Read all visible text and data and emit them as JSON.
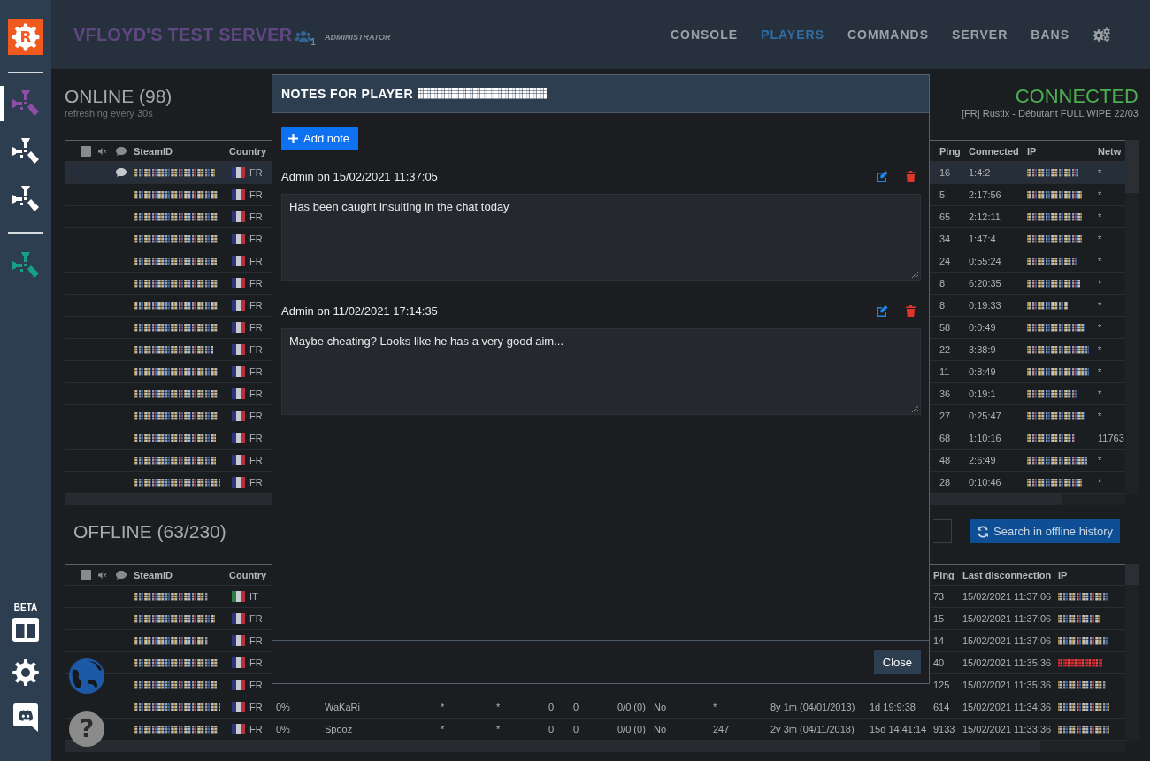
{
  "sidebar": {
    "logo": "R",
    "servers": [
      {
        "color": "#8e4ea8",
        "selected": true
      },
      {
        "color": "#ffffff",
        "selected": false
      },
      {
        "color": "#ffffff",
        "selected": false
      }
    ],
    "other_servers": [
      {
        "color": "#16a085",
        "selected": false
      }
    ],
    "beta_label": "BETA"
  },
  "header": {
    "title": "VFLOYD'S TEST SERVER",
    "users_count": "1",
    "role": "ADMINISTRATOR",
    "nav": [
      {
        "label": "CONSOLE",
        "selected": false
      },
      {
        "label": "PLAYERS",
        "selected": true
      },
      {
        "label": "COMMANDS",
        "selected": false
      },
      {
        "label": "SERVER",
        "selected": false
      },
      {
        "label": "BANS",
        "selected": false
      }
    ]
  },
  "online": {
    "title": "ONLINE (98)",
    "subtitle": "refreshing every 30s",
    "status": "CONNECTED",
    "server_name": "[FR] Rustix - Débutant FULL WIPE 22/03",
    "columns_left": [
      "SteamID",
      "Country"
    ],
    "columns_right": [
      "Ping",
      "Connected",
      "IP",
      "Netw"
    ],
    "rows": [
      {
        "kind": "france",
        "selected": true,
        "chat": true,
        "country": "FR",
        "ping": "16",
        "connected": "1:4:2",
        "network": "*"
      },
      {
        "kind": "france",
        "selected": false,
        "chat": false,
        "country": "FR",
        "ping": "5",
        "connected": "2:17:56",
        "network": "*"
      },
      {
        "kind": "france",
        "selected": false,
        "chat": false,
        "country": "FR",
        "ping": "65",
        "connected": "2:12:11",
        "network": "*"
      },
      {
        "kind": "france",
        "selected": false,
        "chat": false,
        "country": "FR",
        "ping": "34",
        "connected": "1:47:4",
        "network": "*"
      },
      {
        "kind": "france",
        "selected": false,
        "chat": false,
        "country": "FR",
        "ping": "24",
        "connected": "0:55:24",
        "network": "*"
      },
      {
        "kind": "france",
        "selected": false,
        "chat": false,
        "country": "FR",
        "ping": "8",
        "connected": "6:20:35",
        "network": "*"
      },
      {
        "kind": "france",
        "selected": false,
        "chat": false,
        "country": "FR",
        "ping": "8",
        "connected": "0:19:33",
        "network": "*"
      },
      {
        "kind": "france",
        "selected": false,
        "chat": false,
        "country": "FR",
        "ping": "58",
        "connected": "0:0:49",
        "network": "*"
      },
      {
        "kind": "france",
        "selected": false,
        "chat": false,
        "country": "FR",
        "ping": "22",
        "connected": "3:38:9",
        "network": "*"
      },
      {
        "kind": "france",
        "selected": false,
        "chat": false,
        "country": "FR",
        "ping": "11",
        "connected": "0:8:49",
        "network": "*"
      },
      {
        "kind": "france",
        "selected": false,
        "chat": false,
        "country": "FR",
        "ping": "36",
        "connected": "0:19:1",
        "network": "*"
      },
      {
        "kind": "france",
        "selected": false,
        "chat": false,
        "country": "FR",
        "ping": "27",
        "connected": "0:25:47",
        "network": "*"
      },
      {
        "kind": "france",
        "selected": false,
        "chat": false,
        "country": "FR",
        "ping": "68",
        "connected": "1:10:16",
        "network": "11763"
      },
      {
        "kind": "france",
        "selected": false,
        "chat": false,
        "country": "FR",
        "ping": "48",
        "connected": "2:6:49",
        "network": "*"
      },
      {
        "kind": "france",
        "selected": false,
        "chat": false,
        "country": "FR",
        "ping": "28",
        "connected": "0:10:46",
        "network": "*"
      }
    ]
  },
  "offline": {
    "title": "OFFLINE (63/230)",
    "search_button": "Search in offline history",
    "columns_left": [
      "SteamID",
      "Country"
    ],
    "columns_right": [
      "Ping",
      "Last disconnection",
      "IP"
    ],
    "rows": [
      {
        "kind": "italy",
        "country": "IT",
        "ping": "73",
        "last_disconnection": "15/02/2021 11:37:06",
        "ip_flagged": false
      },
      {
        "kind": "france",
        "country": "FR",
        "ping": "15",
        "last_disconnection": "15/02/2021 11:37:06",
        "ip_flagged": false
      },
      {
        "kind": "france",
        "country": "FR",
        "ping": "14",
        "last_disconnection": "15/02/2021 11:37:06",
        "ip_flagged": false
      },
      {
        "kind": "france",
        "country": "FR",
        "ping": "40",
        "last_disconnection": "15/02/2021 11:35:36",
        "ip_flagged": true
      },
      {
        "kind": "france",
        "country": "FR",
        "ping": "125",
        "last_disconnection": "15/02/2021 11:35:36",
        "ip_flagged": false
      },
      {
        "kind": "france",
        "country": "FR",
        "cells": [
          "0%",
          "WaKaRi",
          "*",
          "*",
          "0",
          "0",
          "0/0 (0)",
          "No",
          "*",
          "8y 1m (04/01/2013)",
          "1d 19:9:38"
        ],
        "ping": "614",
        "last_disconnection": "15/02/2021 11:34:36",
        "ip_flagged": false
      },
      {
        "kind": "france",
        "country": "FR",
        "cells": [
          "0%",
          "Spooz",
          "*",
          "*",
          "0",
          "0",
          "0/0 (0)",
          "No",
          "247",
          "2y 3m (04/11/2018)",
          "15d 14:41:14"
        ],
        "ping": "9133",
        "last_disconnection": "15/02/2021 11:33:36",
        "ip_flagged": false
      }
    ]
  },
  "modal": {
    "title": "NOTES FOR PLAYER",
    "add_button": "Add note",
    "notes": [
      {
        "header": "Admin on 15/02/2021 11:37:05",
        "text": "Has been caught insulting in the chat today"
      },
      {
        "header": "Admin on 11/02/2021 17:14:35",
        "text": "Maybe cheating? Looks like he has a very good aim..."
      }
    ],
    "close_button": "Close"
  },
  "floating": {
    "help_label": "?"
  }
}
